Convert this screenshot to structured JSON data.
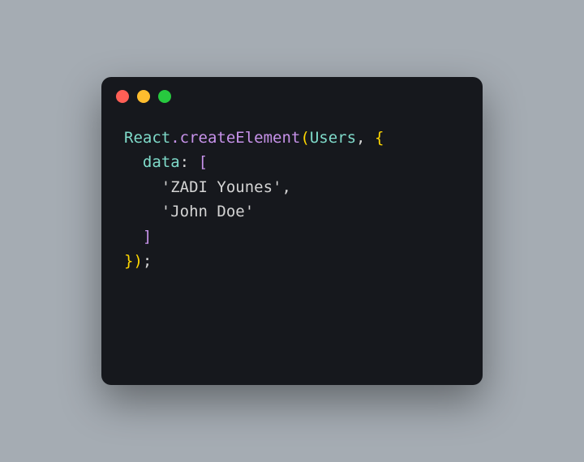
{
  "code": {
    "object": "React",
    "method": "createElement",
    "component": "Users",
    "propKey": "data",
    "strings": {
      "s0": "'ZADI Younes'",
      "s1": "'John Doe'"
    },
    "punct": {
      "dot": ".",
      "lparen": "(",
      "rparen": ")",
      "lbrace": "{",
      "rbrace": "}",
      "lbracket": "[",
      "rbracket": "]",
      "comma": ",",
      "colon": ":",
      "semi": ";",
      "sp": " "
    }
  }
}
